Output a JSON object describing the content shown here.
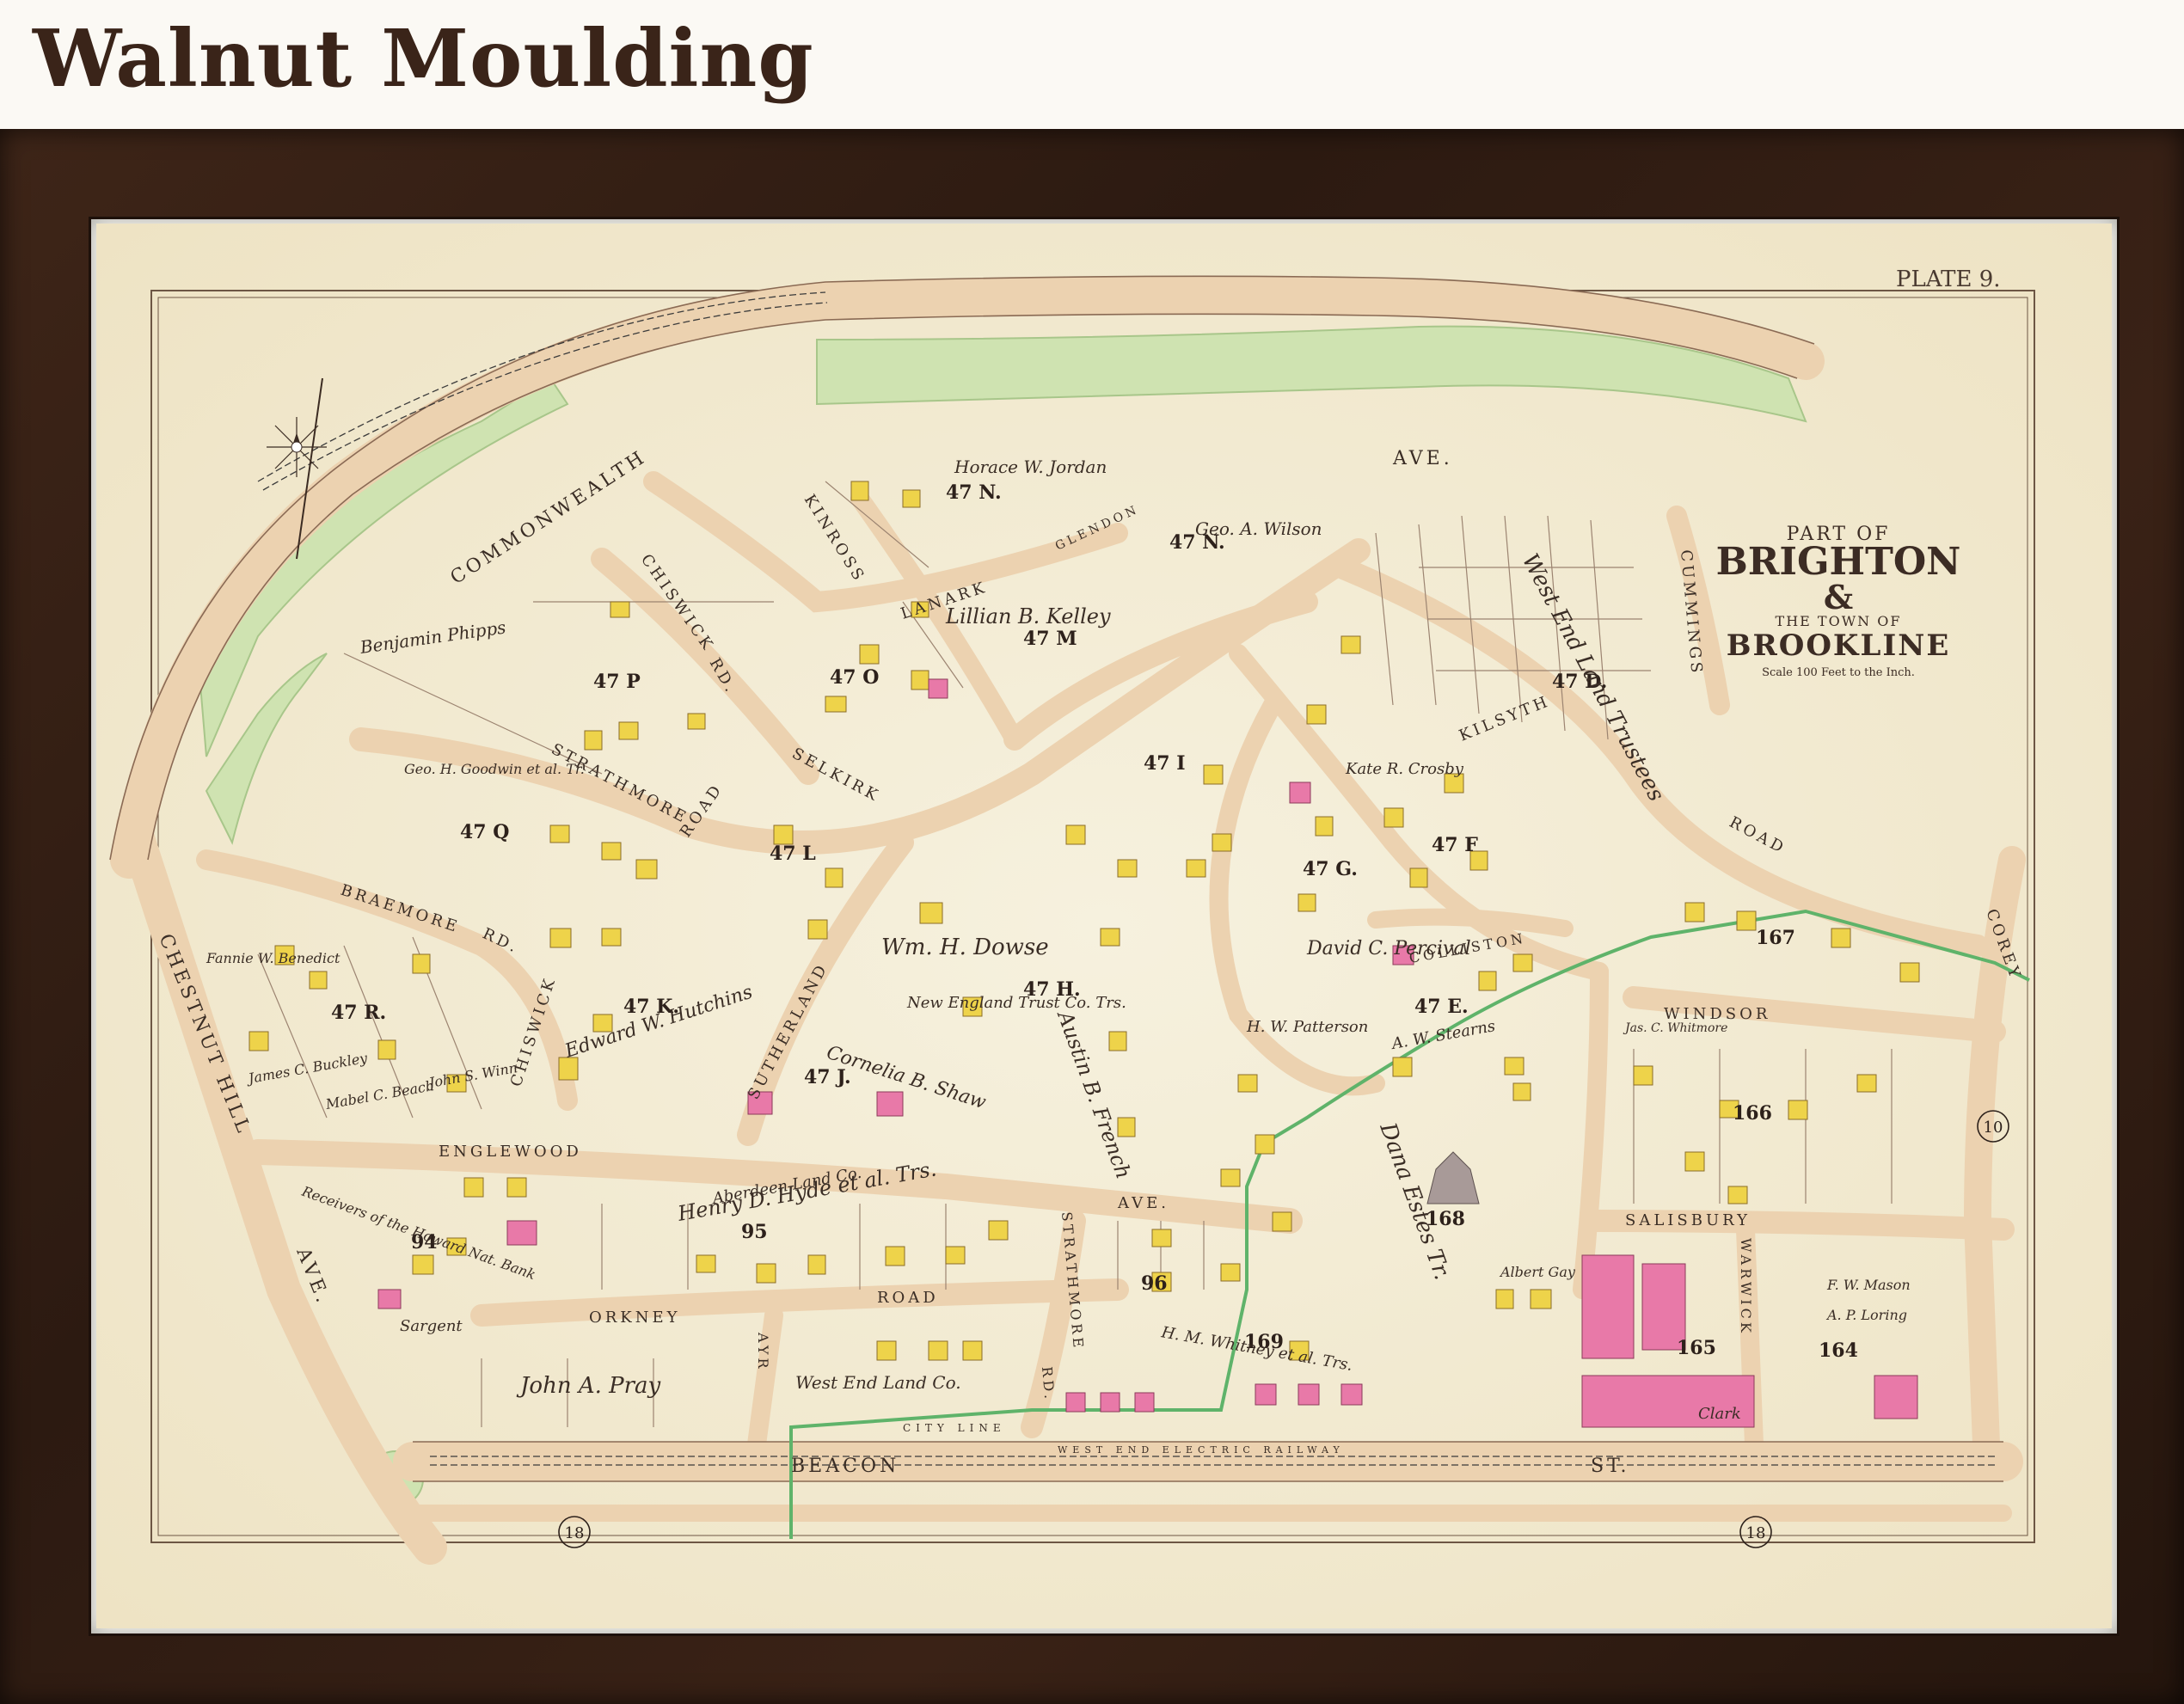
{
  "header": {
    "title": "Walnut Moulding"
  },
  "plate": {
    "label": "PLATE 9."
  },
  "cartouche": {
    "line1": "PART OF",
    "line2": "BRIGHTON",
    "line3": "&",
    "line4": "THE TOWN OF",
    "line5": "BROOKLINE",
    "scale": "Scale 100 Feet to the Inch."
  },
  "streets": {
    "commonwealth": "COMMONWEALTH",
    "ave": "AVE.",
    "chestnut_hill": "CHESTNUT HILL",
    "ave2": "AVE.",
    "chiswick_rd": "CHISWICK",
    "rd": "RD.",
    "strathmore": "STRATHMORE",
    "road": "ROAD",
    "braemore": "BRAEMORE",
    "braemore_rd": "RD.",
    "chiswick2": "CHISWICK",
    "selkirk": "SELKIRK",
    "kinross": "KINROSS",
    "lanark": "LANARK",
    "glendon": "GLENDON",
    "englewood": "ENGLEWOOD",
    "sutherland": "SUTHERLAND",
    "orkney": "ORKNEY",
    "road2": "ROAD",
    "ayr": "AYR",
    "beacon": "BEACON",
    "st": "ST.",
    "railway": "WEST END ELECTRIC RAILWAY",
    "kilsyth": "KILSYTH",
    "colliston": "COLLISTON",
    "windsor": "WINDSOR",
    "salisbury": "SALISBURY",
    "warwick": "WARWICK",
    "cummings": "CUMMINGS",
    "corey": "COREY",
    "road3": "ROAD",
    "ave3": "AVE.",
    "strathmore2": "STRATHMORE",
    "rd2": "RD.",
    "city_line": "CITY LINE"
  },
  "lots": {
    "n47": "47 N.",
    "n47b": "47 N.",
    "m47": "47 M",
    "p47": "47 P",
    "o47": "47 O",
    "q47": "47 Q",
    "l47": "47 L",
    "k47": "47 K.",
    "r47": "47 R.",
    "i47": "47 I",
    "h47": "47 H.",
    "j47": "47 J.",
    "g47": "47 G.",
    "f47": "47 F",
    "e47": "47 E.",
    "d47": "47 D.",
    "n95": "95",
    "n94": "94",
    "n96": "96",
    "n168": "168",
    "n169": "169",
    "n165": "165",
    "n164": "164",
    "n166": "166",
    "n167": "167",
    "n10": "10",
    "n18a": "18",
    "n18b": "18"
  },
  "owners": {
    "jordan": "Horace W. Jordan",
    "wilson": "Geo. A. Wilson",
    "phipps": "Benjamin Phipps",
    "kelley": "Lillian B. Kelley",
    "hutchins": "Edward W. Hutchins",
    "dowse": "Wm. H. Dowse",
    "nett": "New England Trust Co. Trs.",
    "french": "Austin B. French",
    "shaw": "Cornelia B. Shaw",
    "hyde": "Henry D. Hyde et al. Trs.",
    "aberdeen": "Aberdeen Land Co.",
    "pray": "John A. Pray",
    "whitney": "H. M. Whitney et al. Trs.",
    "westend": "West End Land Co.",
    "westendtrs": "West End Land Trustees",
    "dana": "Dana Estes Tr.",
    "percival": "David C. Percival",
    "patterson": "H. W. Patterson",
    "crosby": "Kate R. Crosby",
    "sargent": "Sargent",
    "receivers": "Receivers of the Howard Nat. Bank",
    "goodwin": "Geo. H. Goodwin et al. Tr.",
    "benedict": "Fannie W. Benedict",
    "buckley": "James C. Buckley",
    "beach": "Mabel C. Beach",
    "winn": "John S. Winn",
    "stearns": "A. W. Stearns",
    "whitmore": "Jas. C. Whitmore",
    "loring": "A. P. Loring",
    "mason": "F. W. Mason",
    "gay": "Albert Gay",
    "clark": "Clark"
  },
  "colors": {
    "paper": "#f4efd9",
    "road": "#ecd2b0",
    "park": "#cfe3b1",
    "building_wood": "#eed34a",
    "building_brick": "#e879a8",
    "line": "#8a6a54",
    "city_line": "#5fb36a"
  }
}
